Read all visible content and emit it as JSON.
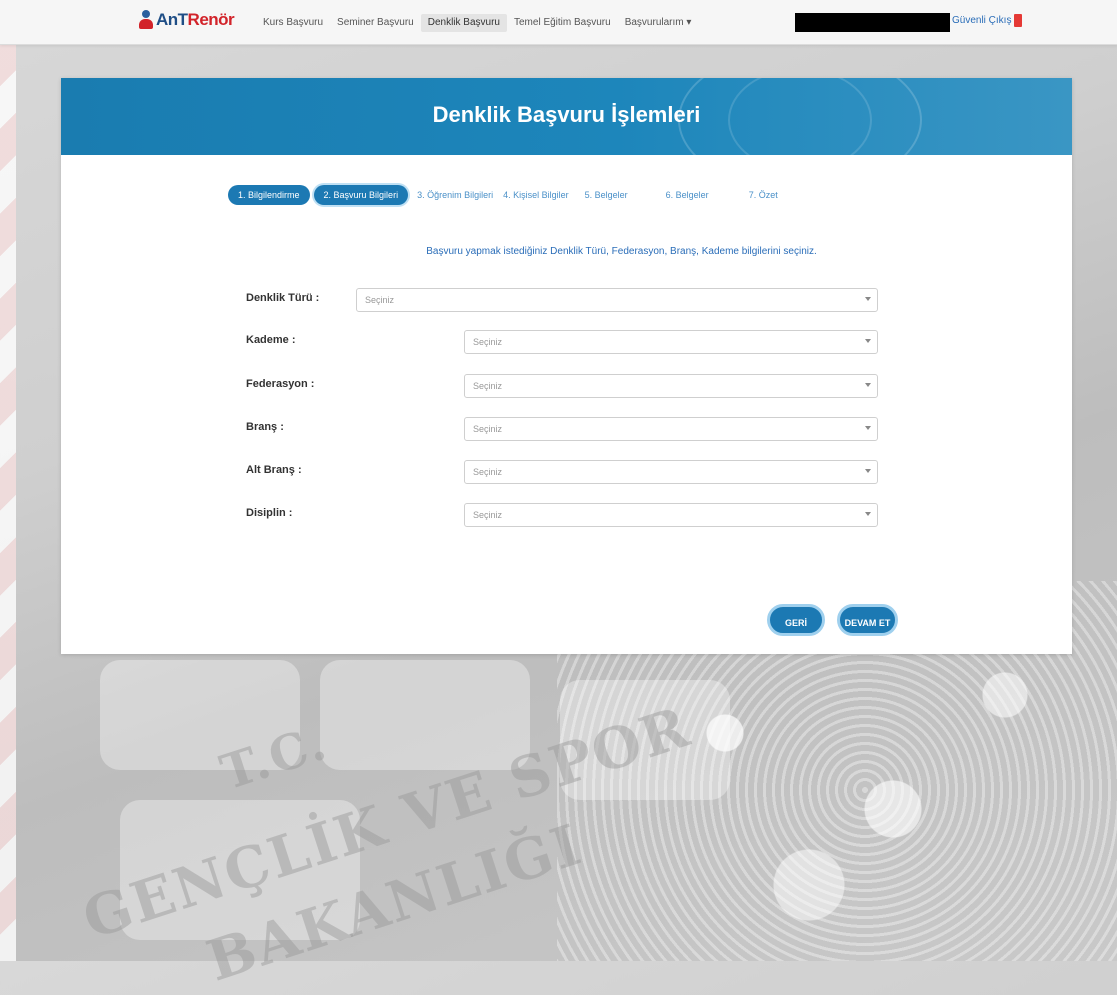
{
  "navbar": {
    "brand_prefix": "AnT",
    "brand_suffix": "Renör",
    "menu": [
      {
        "label": "Kurs Başvuru"
      },
      {
        "label": "Seminer Başvuru"
      },
      {
        "label": "Denklik Başvuru"
      },
      {
        "label": "Temel Eğitim Başvuru"
      },
      {
        "label": "Başvurularım ▾"
      }
    ],
    "logout_label": "Güvenli Çıkış"
  },
  "page": {
    "title": "Denklik Başvuru İşlemleri",
    "steps": [
      {
        "label": "1. Bilgilendirme"
      },
      {
        "label": "2. Başvuru Bilgileri"
      },
      {
        "label": "3. Öğrenim Bilgileri"
      },
      {
        "label": "4. Kişisel Bilgiler"
      },
      {
        "label": "5. Belgeler"
      },
      {
        "label": "6. Belgeler"
      },
      {
        "label": "7. Özet"
      }
    ],
    "intro": "Başvuru yapmak istediğiniz Denklik Türü, Federasyon, Branş, Kademe bilgilerini seçiniz."
  },
  "form": {
    "fields": [
      {
        "label": "Denklik Türü :",
        "value": "Seçiniz"
      },
      {
        "label": "Kademe :",
        "value": "Seçiniz"
      },
      {
        "label": "Federasyon :",
        "value": "Seçiniz"
      },
      {
        "label": "Branş :",
        "value": "Seçiniz"
      },
      {
        "label": "Alt Branş :",
        "value": "Seçiniz"
      },
      {
        "label": "Disiplin :",
        "value": "Seçiniz"
      }
    ]
  },
  "actions": {
    "back_label": "GERİ",
    "next_label": "DEVAM ET"
  },
  "background": {
    "watermark_line1": "T.C.",
    "watermark_line2": "GENÇLİK VE SPOR",
    "watermark_line3": "BAKANLIĞI"
  },
  "colors": {
    "primary": "#1c79b3",
    "header_bg": "#1d86bb",
    "link": "#2a6db8",
    "brand_red": "#d2232a"
  }
}
